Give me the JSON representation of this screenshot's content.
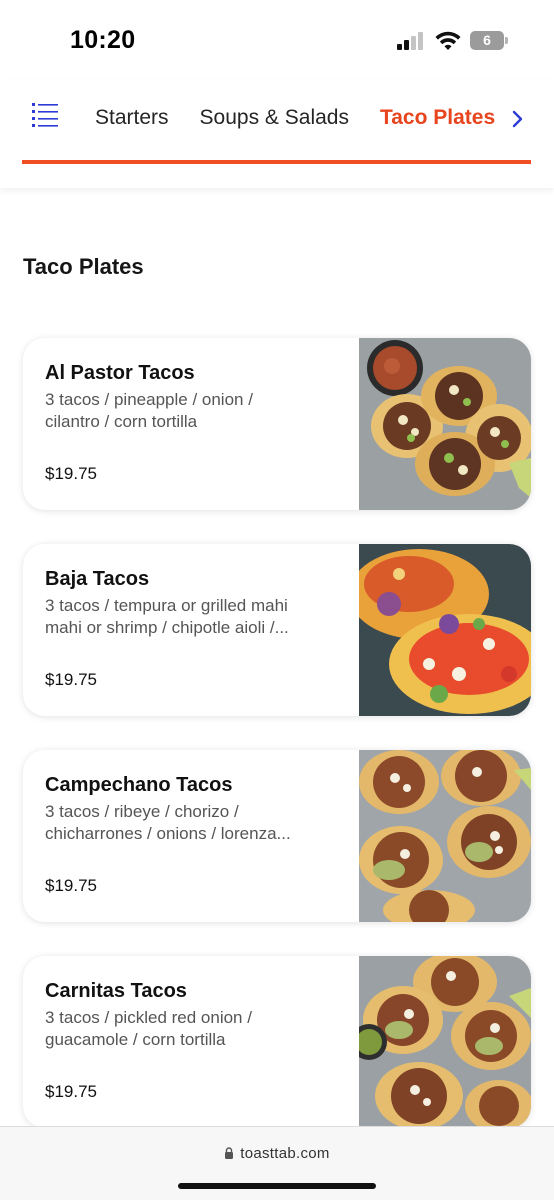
{
  "status_bar": {
    "time": "10:20",
    "battery": "6",
    "icons": [
      "signal-icon",
      "wifi-icon",
      "battery-icon"
    ]
  },
  "nav": {
    "menu_icon": "menu-list-icon",
    "tabs": [
      {
        "label": "Starters",
        "active": false
      },
      {
        "label": "Soups & Salads",
        "active": false
      },
      {
        "label": "Taco Plates",
        "active": true
      }
    ],
    "next_icon": "chevron-right-icon",
    "accent_color": "#f04e23"
  },
  "section": {
    "title": "Taco Plates"
  },
  "items": [
    {
      "name": "Al Pastor Tacos",
      "desc_line1": "3 tacos / pineapple / onion /",
      "desc_line2": "cilantro / corn tortilla",
      "price": "$19.75"
    },
    {
      "name": "Baja Tacos",
      "desc_line1": "3 tacos / tempura or grilled mahi",
      "desc_line2": "mahi or shrimp / chipotle aioli /...",
      "price": "$19.75"
    },
    {
      "name": "Campechano Tacos",
      "desc_line1": "3 tacos / ribeye / chorizo /",
      "desc_line2": "chicharrones / onions / lorenza...",
      "price": "$19.75"
    },
    {
      "name": "Carnitas Tacos",
      "desc_line1": "3 tacos / pickled red onion /",
      "desc_line2": "guacamole / corn tortilla",
      "price": "$19.75"
    }
  ],
  "browser": {
    "url": "toasttab.com",
    "lock_icon": "lock-icon"
  }
}
